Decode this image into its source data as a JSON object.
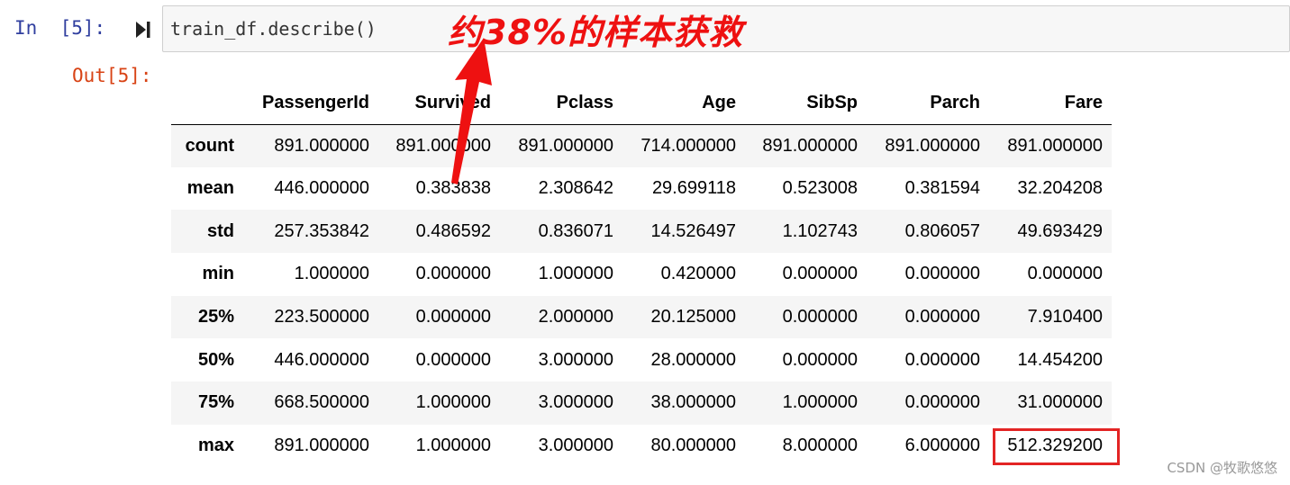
{
  "cell": {
    "in_prompt": "In  [5]:",
    "out_prompt": "Out[5]:",
    "code": "train_df.describe()"
  },
  "annotation": {
    "text": "约38%的样本获救",
    "color": "#ee1111"
  },
  "table": {
    "columns": [
      "PassengerId",
      "Survived",
      "Pclass",
      "Age",
      "SibSp",
      "Parch",
      "Fare"
    ],
    "rows": [
      {
        "label": "count",
        "values": [
          "891.000000",
          "891.000000",
          "891.000000",
          "714.000000",
          "891.000000",
          "891.000000",
          "891.000000"
        ]
      },
      {
        "label": "mean",
        "values": [
          "446.000000",
          "0.383838",
          "2.308642",
          "29.699118",
          "0.523008",
          "0.381594",
          "32.204208"
        ]
      },
      {
        "label": "std",
        "values": [
          "257.353842",
          "0.486592",
          "0.836071",
          "14.526497",
          "1.102743",
          "0.806057",
          "49.693429"
        ]
      },
      {
        "label": "min",
        "values": [
          "1.000000",
          "0.000000",
          "1.000000",
          "0.420000",
          "0.000000",
          "0.000000",
          "0.000000"
        ]
      },
      {
        "label": "25%",
        "values": [
          "223.500000",
          "0.000000",
          "2.000000",
          "20.125000",
          "0.000000",
          "0.000000",
          "7.910400"
        ]
      },
      {
        "label": "50%",
        "values": [
          "446.000000",
          "0.000000",
          "3.000000",
          "28.000000",
          "0.000000",
          "0.000000",
          "14.454200"
        ]
      },
      {
        "label": "75%",
        "values": [
          "668.500000",
          "1.000000",
          "3.000000",
          "38.000000",
          "1.000000",
          "0.000000",
          "31.000000"
        ]
      },
      {
        "label": "max",
        "values": [
          "891.000000",
          "1.000000",
          "3.000000",
          "80.000000",
          "8.000000",
          "6.000000",
          "512.329200"
        ]
      }
    ]
  },
  "highlight": {
    "row": "max",
    "column": "Fare",
    "color": "#e32424"
  },
  "watermark": "CSDN @牧歌悠悠",
  "icons": {
    "run": "run-cell-icon"
  },
  "colors": {
    "in_prompt": "#303F9F",
    "out_prompt": "#D84315",
    "cell_background": "#f7f7f7",
    "row_stripe": "#f5f5f5"
  }
}
